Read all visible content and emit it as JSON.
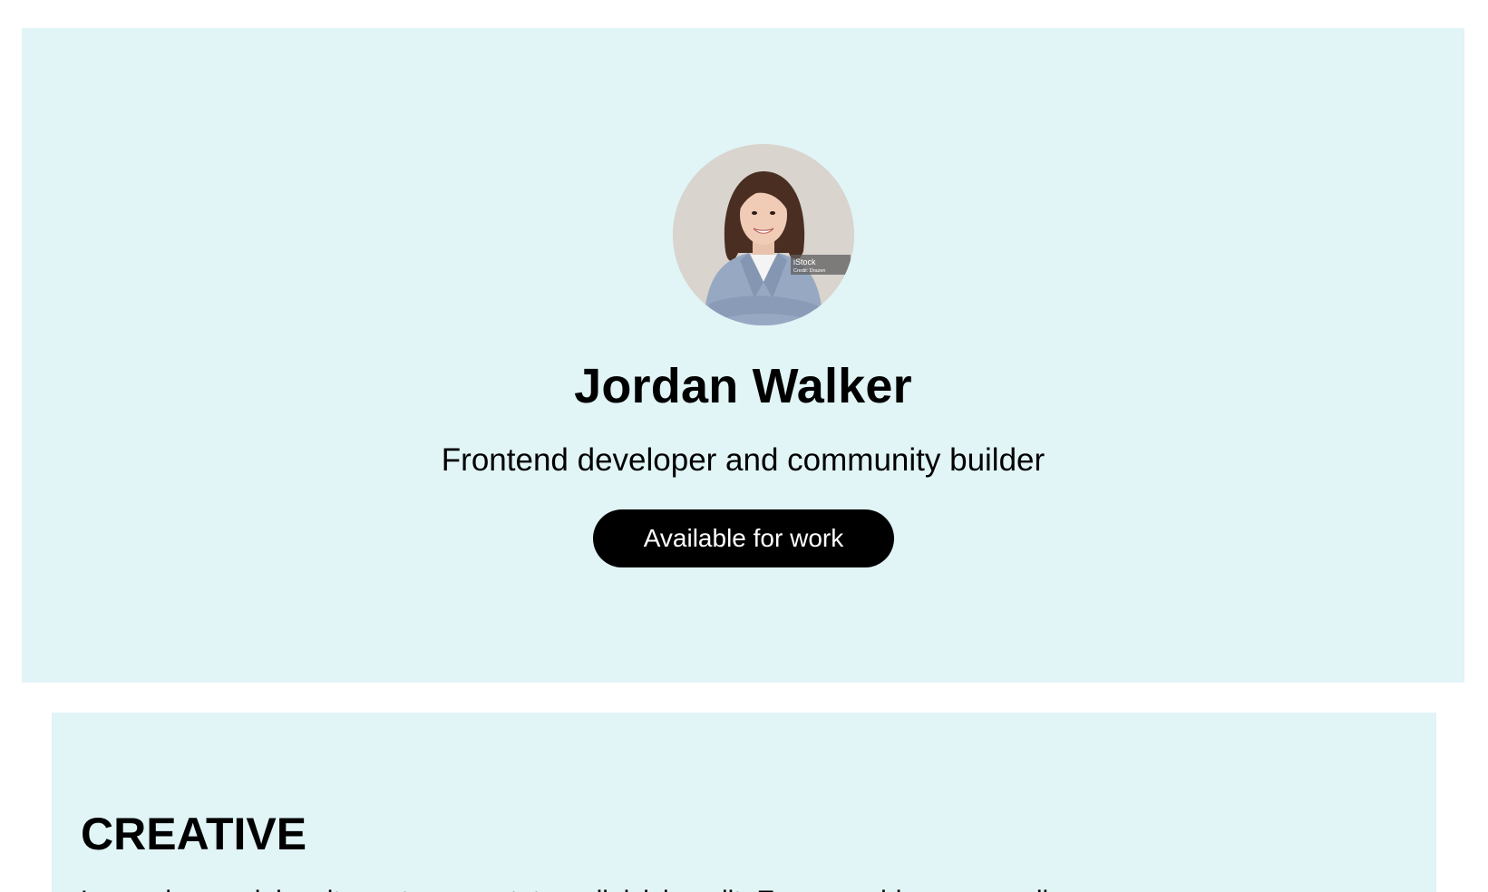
{
  "profile": {
    "name": "Jordan Walker",
    "tagline": "Frontend developer and community builder",
    "cta_label": "Available for work",
    "avatar_watermark": "iStock",
    "avatar_credit": "Credit: Drazen"
  },
  "section": {
    "title": "CREATIVE",
    "text": "Lorem ipsum dolor sit amet, consectetur adipisicing elit. Eaque, quidem, quos ullam"
  },
  "colors": {
    "background": "#e1f4f6",
    "button": "#000000",
    "button_text": "#ffffff"
  }
}
